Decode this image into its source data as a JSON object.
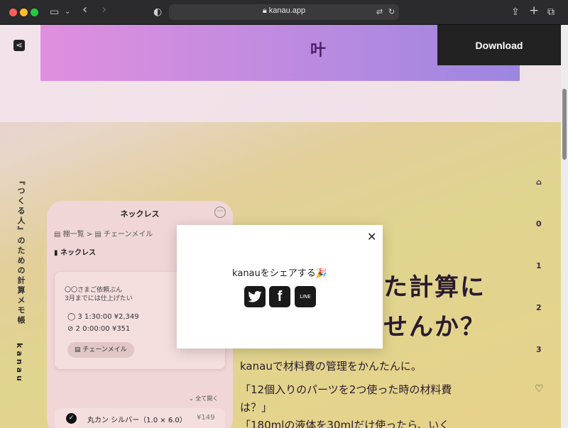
{
  "browser": {
    "url": "kanau.app",
    "back_icon": "‹",
    "forward_icon": "›"
  },
  "header": {
    "logo": "叶",
    "download_label": "Download"
  },
  "sidebar": {
    "tagline": "『つくる人』のための計算メモ帳",
    "brand": "kanau"
  },
  "right_nav": {
    "items": [
      "0",
      "1",
      "2",
      "3"
    ]
  },
  "phone": {
    "title": "ネックレス",
    "breadcrumb": "▤ 棚一覧   >   ▤ チェーンメイル",
    "current": "▮ ネックレス",
    "card": {
      "line1": "〇〇さまご依頼ぶん",
      "line2": "3月までには仕上げたい",
      "row1": "◯  3  1:30:00  ¥2,349",
      "row2": "⊘  2  0:00:00  ¥351",
      "chip": "▤ チェーンメイル"
    },
    "expand_all": "⌄ 全て開く",
    "item": {
      "name": "丸カン シルバー（1.0 × 6.0）",
      "price": "¥149"
    }
  },
  "hero_text": {
    "line1": "た計算に",
    "line2": "せんか？",
    "body1": "kanauで材料費の管理をかんたんに。",
    "body2": "「12個入りのパーツを2つ使った時の材料費",
    "body3": "は？」",
    "body4": "「180mlの液体を30mlだけ使ったら、いく"
  },
  "modal": {
    "title": "kanauをシェアする🎉",
    "line_label": "LINE",
    "close": "✕"
  }
}
